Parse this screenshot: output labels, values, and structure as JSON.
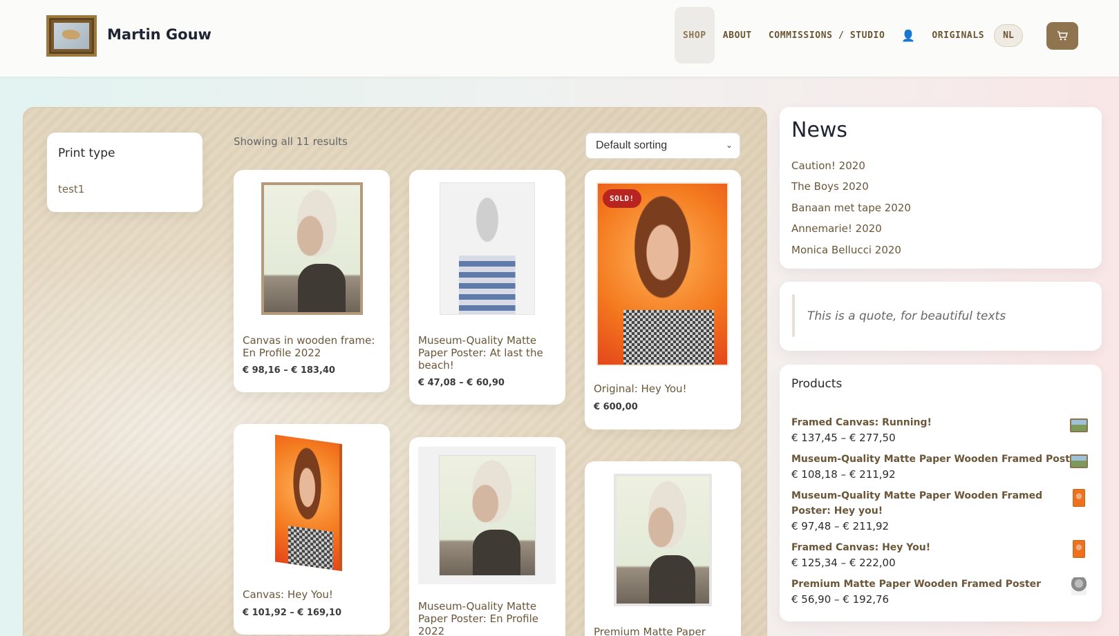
{
  "header": {
    "site_title": "Martin Gouw",
    "nav": [
      {
        "label": "SHOP"
      },
      {
        "label": "ABOUT"
      },
      {
        "label": "COMMISSIONS / STUDIO"
      },
      {
        "label": "ORIGINALS"
      }
    ],
    "user_icon": "user-icon",
    "language": "NL",
    "cart_icon": "cart-icon"
  },
  "filter": {
    "title": "Print type",
    "options": [
      "test1"
    ]
  },
  "shop": {
    "result_count": "Showing all 11 results",
    "sort_selected": "Default sorting",
    "products": [
      {
        "name": "Canvas in wooden frame: En Profile 2022",
        "price": "€ 98,16 – € 183,40"
      },
      {
        "name": "Museum-Quality Matte Paper Poster: At last the beach!",
        "price": "€ 47,08 – € 60,90"
      },
      {
        "name": "Original: Hey You!",
        "price": "€ 600,00",
        "badge": "SOLD!"
      },
      {
        "name": "Canvas: Hey You!",
        "price": "€ 101,92 – € 169,10"
      },
      {
        "name": "Museum-Quality Matte Paper Poster: En Profile 2022",
        "price": ""
      },
      {
        "name": "Premium Matte Paper",
        "price": ""
      }
    ]
  },
  "sidebar": {
    "news": {
      "title": "News",
      "items": [
        "Caution! 2020",
        "The Boys 2020",
        "Banaan met tape 2020",
        "Annemarie! 2020",
        "Monica Bellucci 2020"
      ]
    },
    "quote": "This is a quote, for beautiful texts",
    "products": {
      "title": "Products",
      "items": [
        {
          "name": "Framed Canvas: Running!",
          "price": "€ 137,45 – € 277,50"
        },
        {
          "name": "Museum-Quality Matte Paper Wooden Framed Poster",
          "price": "€ 108,18 – € 211,92"
        },
        {
          "name": "Museum-Quality Matte Paper Wooden Framed Poster: Hey you!",
          "price": "€ 97,48 – € 211,92"
        },
        {
          "name": "Framed Canvas: Hey You!",
          "price": "€ 125,34 – € 222,00"
        },
        {
          "name": "Premium Matte Paper Wooden Framed Poster",
          "price": "€ 56,90 – € 192,76"
        }
      ]
    }
  }
}
